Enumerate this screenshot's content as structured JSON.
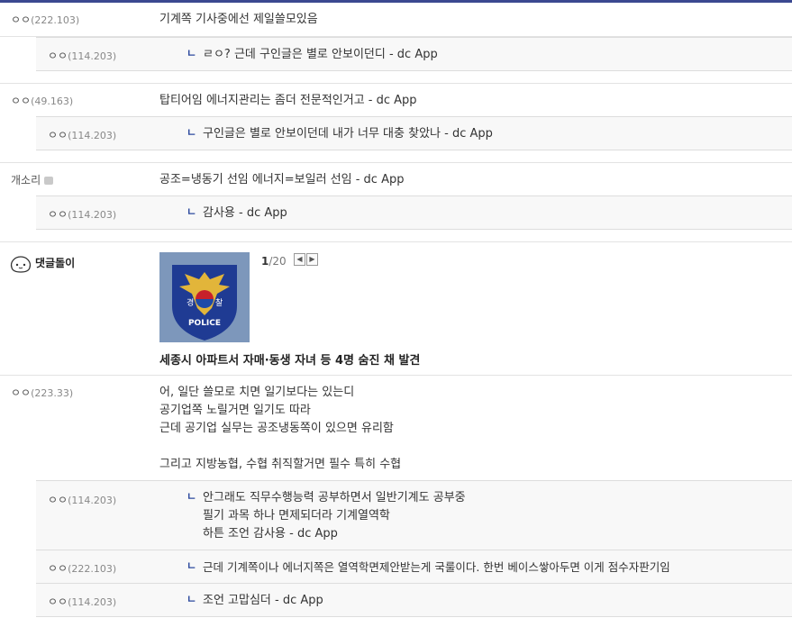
{
  "comments": [
    {
      "nick": "ㅇㅇ",
      "ip": "(222.103)",
      "text": "기계쪽 기사중에선 제일쓸모있음",
      "replies": [
        {
          "nick": "ㅇㅇ",
          "ip": "(114.203)",
          "lines": [
            "ㄹㅇ? 근데 구인글은 별로 안보이던디 - dc App"
          ]
        }
      ]
    },
    {
      "nick": "ㅇㅇ",
      "ip": "(49.163)",
      "text": "탑티어임 에너지관리는 좀더 전문적인거고 - dc App",
      "replies": [
        {
          "nick": "ㅇㅇ",
          "ip": "(114.203)",
          "lines": [
            "구인글은 별로 안보이던데 내가 너무 대충 찾았나 - dc App"
          ]
        }
      ]
    },
    {
      "nick": "개소리",
      "ip": "",
      "text": "공조=냉동기 선임 에너지=보일러 선임 - dc App",
      "replies": [
        {
          "nick": "ㅇㅇ",
          "ip": "(114.203)",
          "lines": [
            "감사용 - dc App"
          ]
        }
      ]
    }
  ],
  "bot": {
    "name": "댓글돌이",
    "page_current": "1",
    "page_total": "/20",
    "image_text_left": "경",
    "image_text_right": "찰",
    "image_banner": "POLICE",
    "headline": "세종시 아파트서 자매·동생 자녀 등 4명 숨진 채 발견"
  },
  "last_comment": {
    "nick": "ㅇㅇ",
    "ip": "(223.33)",
    "lines": [
      "어, 일단 쓸모로 치면 일기보다는 있는디",
      "공기업쪽 노릴거면 일기도 따라",
      "근데 공기업 실무는 공조냉동쪽이 있으면 유리함",
      "",
      "그리고 지방농협, 수협 취직할거면 필수 특히 수협"
    ],
    "replies": [
      {
        "nick": "ㅇㅇ",
        "ip": "(114.203)",
        "lines": [
          "안그래도 직무수행능력 공부하면서 일반기계도 공부중",
          "필기 과목 하나 면제되더라 기계열역학",
          "하튼 조언 감사용 - dc App"
        ]
      },
      {
        "nick": "ㅇㅇ",
        "ip": "(222.103)",
        "lines": [
          "근데 기계쪽이나 에너지쪽은 열역학면제안받는게 국룰이다. 한번 베이스쌓아두면 이게 점수자판기임"
        ]
      },
      {
        "nick": "ㅇㅇ",
        "ip": "(114.203)",
        "lines": [
          "조언 고맙심더 - dc App"
        ]
      }
    ]
  },
  "reply_arrow": "ㄴ",
  "colors": {
    "accent": "#3b4890",
    "reply_bg": "#f8f8f8",
    "arrow": "#2d4a9e"
  }
}
